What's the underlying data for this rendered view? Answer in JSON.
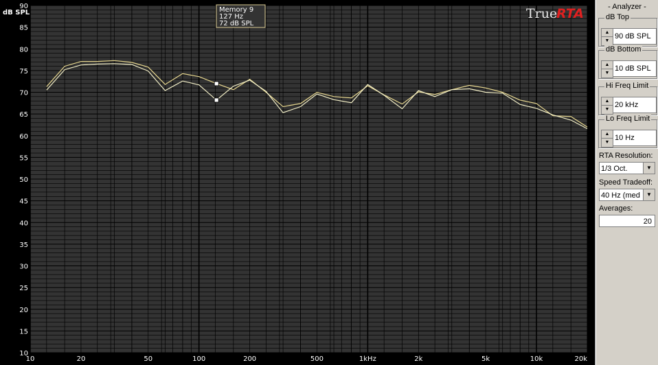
{
  "chart_data": {
    "type": "line",
    "ylabel": "dB SPL",
    "ylim": [
      10,
      90
    ],
    "y_ticks": [
      10,
      15,
      20,
      25,
      30,
      35,
      40,
      45,
      50,
      55,
      60,
      65,
      70,
      75,
      80,
      85,
      90
    ],
    "xlim_hz": [
      10,
      20000
    ],
    "x_scale": "log",
    "x_ticks": [
      {
        "hz": 10,
        "label": "10"
      },
      {
        "hz": 20,
        "label": "20"
      },
      {
        "hz": 50,
        "label": "50"
      },
      {
        "hz": 100,
        "label": "100"
      },
      {
        "hz": 200,
        "label": "200"
      },
      {
        "hz": 500,
        "label": "500"
      },
      {
        "hz": 1000,
        "label": "1kHz"
      },
      {
        "hz": 2000,
        "label": "2k"
      },
      {
        "hz": 5000,
        "label": "5k"
      },
      {
        "hz": 10000,
        "label": "10k"
      },
      {
        "hz": 20000,
        "label": "20k"
      }
    ],
    "grid": true,
    "series": [
      {
        "color": "#e8d890",
        "x": [
          12.5,
          16,
          20,
          25,
          31.5,
          40,
          50,
          63,
          80,
          100,
          127,
          160,
          200,
          250,
          315,
          400,
          500,
          630,
          800,
          1000,
          1250,
          1600,
          2000,
          2500,
          3150,
          4000,
          5000,
          6300,
          8000,
          10000,
          12500,
          16000,
          20000
        ],
        "y": [
          71.3,
          76.0,
          77.1,
          77.1,
          77.3,
          76.9,
          75.8,
          71.8,
          74.3,
          73.6,
          72.0,
          70.6,
          73.0,
          70.0,
          66.7,
          67.4,
          70.0,
          69.0,
          68.7,
          71.5,
          69.4,
          67.3,
          70.1,
          69.5,
          70.6,
          71.6,
          71.0,
          70.0,
          68.2,
          67.4,
          64.6,
          64.4,
          62.0
        ]
      },
      {
        "color": "#f4f0c8",
        "x": [
          12.5,
          16,
          20,
          25,
          31.5,
          40,
          50,
          63,
          80,
          100,
          127,
          160,
          200,
          250,
          315,
          400,
          500,
          630,
          800,
          1000,
          1250,
          1600,
          2000,
          2500,
          3150,
          4000,
          5000,
          6300,
          8000,
          10000,
          12500,
          16000,
          20000
        ],
        "y": [
          70.5,
          75.2,
          76.3,
          76.5,
          76.6,
          76.4,
          74.9,
          70.4,
          72.6,
          71.7,
          68.2,
          71.4,
          72.8,
          70.2,
          65.3,
          66.7,
          69.6,
          68.3,
          67.6,
          71.8,
          69.3,
          66.2,
          70.4,
          69.0,
          70.6,
          70.8,
          70.0,
          69.8,
          67.2,
          66.3,
          64.8,
          63.6,
          61.6
        ]
      }
    ],
    "markers": [
      {
        "hz": 127,
        "db": 72.0
      },
      {
        "hz": 127,
        "db": 68.2
      }
    ],
    "tooltip": {
      "name": "Memory 9",
      "freq": "127 Hz",
      "level": "72 dB SPL"
    },
    "brand_true": "True",
    "brand_rta": "RTA",
    "colors": {
      "background": "#000000",
      "plot": "#333333",
      "grid": "#000000",
      "axis_text": "#ffffff",
      "brand_red": "#e02020",
      "brand_white": "#e8e8e8",
      "tooltip_border": "#d8c890"
    }
  },
  "panel": {
    "title": "- Analyzer -",
    "db_top": {
      "label": "dB Top",
      "value": "90 dB SPL"
    },
    "db_bottom": {
      "label": "dB Bottom",
      "value": "10 dB SPL"
    },
    "hi_freq": {
      "label": "Hi Freq Limit",
      "value": "20 kHz"
    },
    "lo_freq": {
      "label": "Lo Freq Limit",
      "value": "10 Hz"
    },
    "rta_res": {
      "label": "RTA Resolution:",
      "value": "1/3 Oct."
    },
    "speed": {
      "label": "Speed Tradeoff:",
      "value": "40 Hz (med"
    },
    "averages": {
      "label": "Averages:",
      "value": "20"
    }
  }
}
